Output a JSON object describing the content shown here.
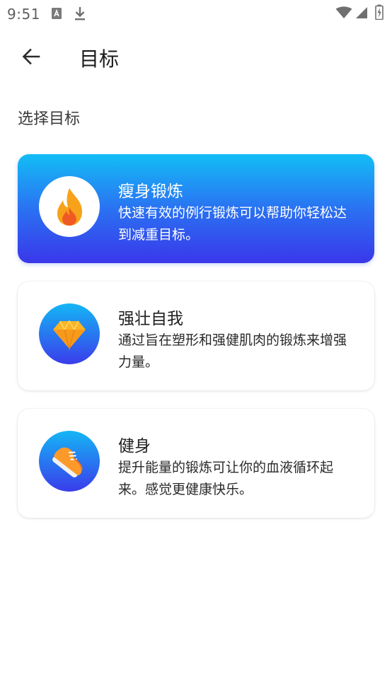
{
  "status_bar": {
    "time": "9:51",
    "icons": [
      "app-notification-icon",
      "download-icon",
      "wifi-icon",
      "signal-icon",
      "battery-charging-icon"
    ]
  },
  "app_bar": {
    "back_icon": "arrow-left-icon",
    "title": "目标"
  },
  "section": {
    "label": "选择目标"
  },
  "goals": [
    {
      "title": "瘦身锻炼",
      "description": "快速有效的例行锻炼可以帮助你轻松达到减重目标。",
      "icon": "flame-icon",
      "selected": true
    },
    {
      "title": "强壮自我",
      "description": "通过旨在塑形和强健肌肉的锻炼来增强力量。",
      "icon": "diamond-icon",
      "selected": false
    },
    {
      "title": "健身",
      "description": "提升能量的锻炼可让你的血液循环起来。感觉更健康快乐。",
      "icon": "sneaker-icon",
      "selected": false
    }
  ],
  "colors": {
    "selected_gradient_top": "#13bdf6",
    "selected_gradient_bottom": "#3a37ea",
    "icon_blue": "#2f6df0",
    "flame_orange": "#f7a21b",
    "flame_red": "#ef5a24"
  }
}
